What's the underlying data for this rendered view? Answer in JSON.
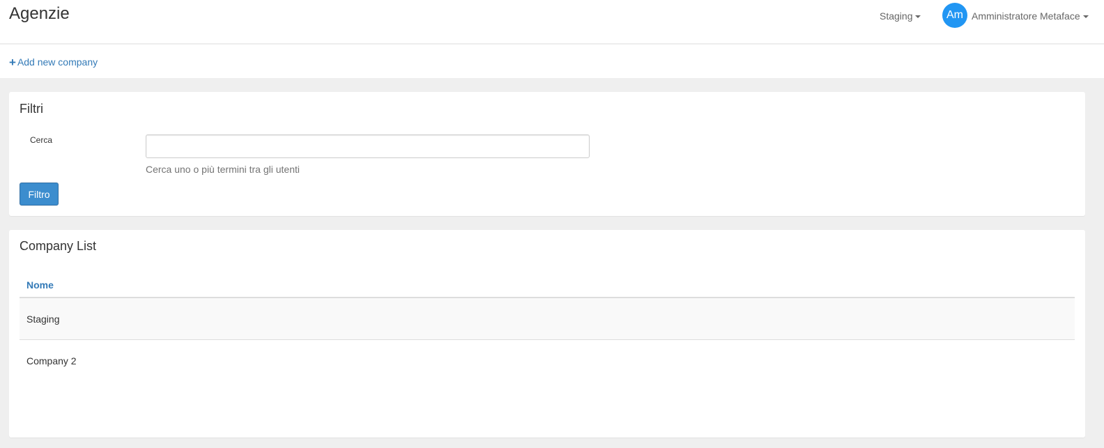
{
  "header": {
    "title": "Agenzie",
    "environment": "Staging",
    "avatar_initials": "Am",
    "user_name": "Amministratore Metaface",
    "avatar_color": "#2196f3"
  },
  "toolbar": {
    "add_label": "Add new company",
    "link_color": "#337ab7"
  },
  "filters": {
    "title": "Filtri",
    "search_label": "Cerca",
    "search_value": "",
    "help_text": "Cerca uno o più termini tra gli utenti",
    "button_label": "Filtro",
    "button_color": "#3c8dce"
  },
  "company_list": {
    "title": "Company List",
    "columns": [
      "Nome"
    ],
    "rows": [
      {
        "name": "Staging"
      },
      {
        "name": "Company 2"
      }
    ]
  }
}
